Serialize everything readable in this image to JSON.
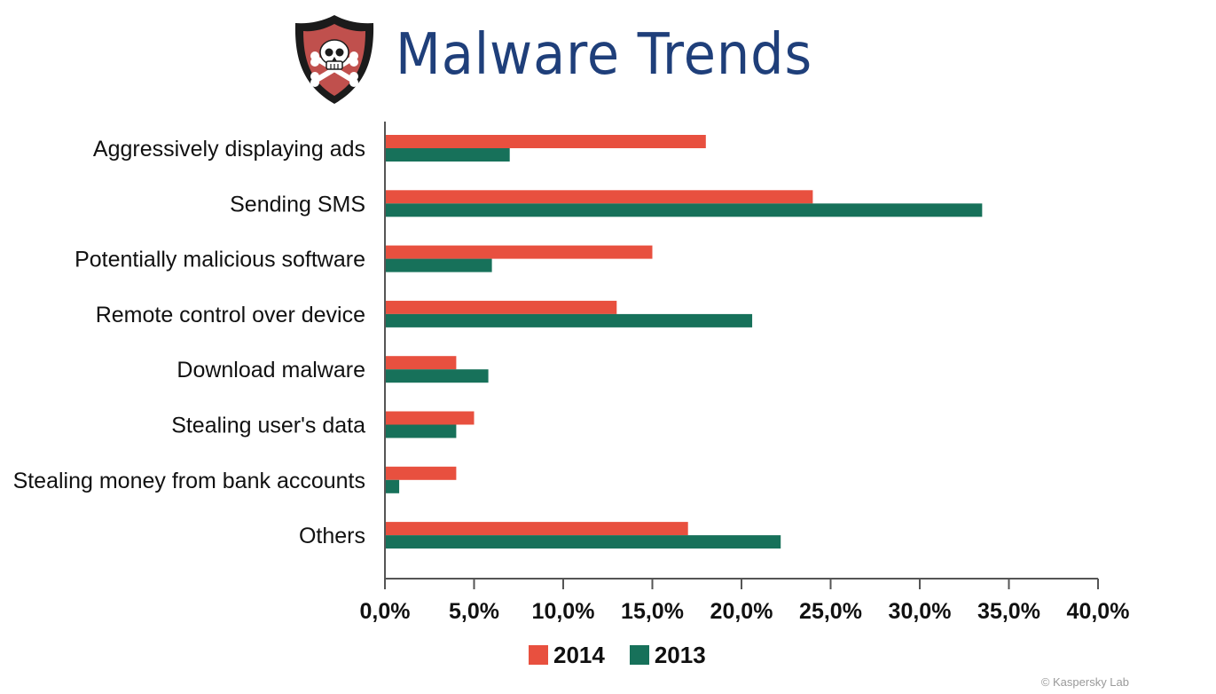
{
  "header": {
    "title": "Malware Trends",
    "logo_icon": "skull-crossbones-shield-icon"
  },
  "colors": {
    "series_2014": "#e8503f",
    "series_2013": "#17715a",
    "title": "#1f3f7a",
    "axis": "#555555",
    "shield_outer": "#1b1b1b",
    "shield_inner": "#c0504d"
  },
  "chart_data": {
    "type": "bar",
    "orientation": "horizontal",
    "title": "",
    "xlabel": "",
    "ylabel": "",
    "xlim": [
      0,
      40
    ],
    "x_ticks": [
      "0,0%",
      "5,0%",
      "10,0%",
      "15,0%",
      "20,0%",
      "25,0%",
      "30,0%",
      "35,0%",
      "40,0%"
    ],
    "grid": false,
    "legend_position": "bottom-center",
    "categories": [
      "Aggressively displaying ads",
      "Sending SMS",
      "Potentially malicious software",
      "Remote control over device",
      "Download malware",
      "Stealing user's data",
      "Stealing money from bank accounts",
      "Others"
    ],
    "series": [
      {
        "name": "2014",
        "values": [
          18.0,
          24.0,
          15.0,
          13.0,
          4.0,
          5.0,
          4.0,
          17.0
        ]
      },
      {
        "name": "2013",
        "values": [
          7.0,
          33.5,
          6.0,
          20.6,
          5.8,
          4.0,
          0.8,
          22.2
        ]
      }
    ]
  },
  "footer": {
    "credit": "© Kaspersky Lab"
  }
}
